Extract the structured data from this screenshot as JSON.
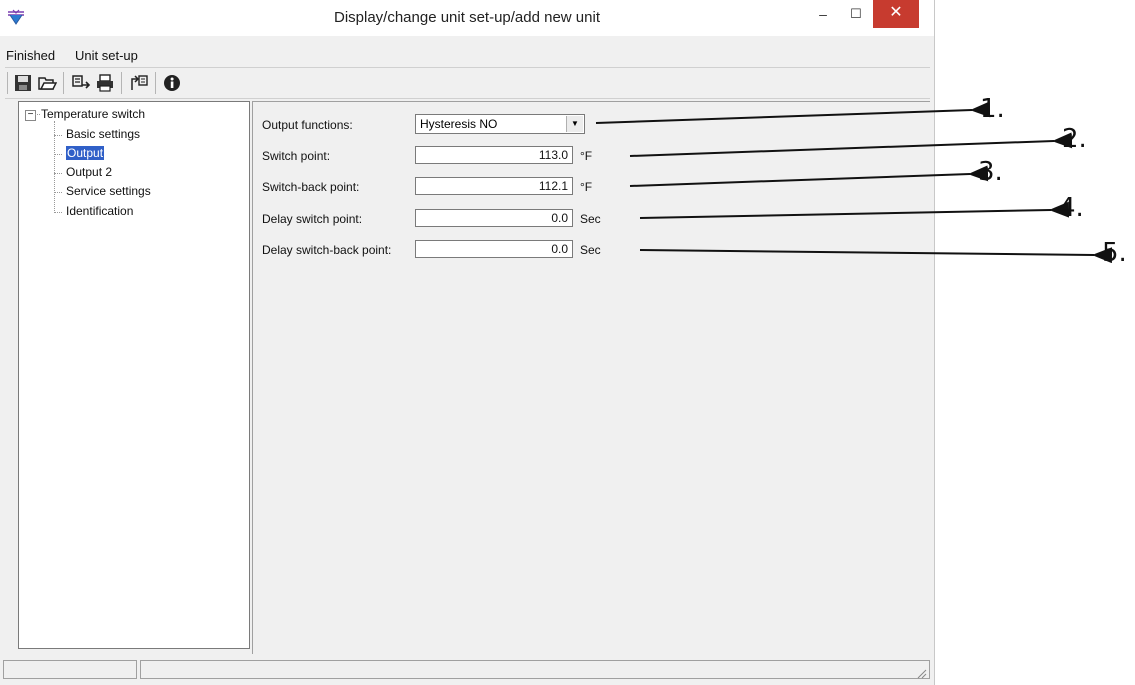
{
  "window": {
    "title": "Display/change unit set-up/add new unit",
    "close_glyph": "✕",
    "min_glyph": "–",
    "max_glyph": "☐"
  },
  "menu": {
    "items": [
      "Finished",
      "Unit set-up"
    ]
  },
  "toolbar": {
    "icons": [
      "save-icon",
      "open-icon",
      "read-unit-icon",
      "print-icon",
      "transfer-unit-icon",
      "info-icon"
    ]
  },
  "tree": {
    "root": "Temperature switch",
    "expander": "−",
    "items": [
      "Basic settings",
      "Output",
      "Output 2",
      "Service settings",
      "Identification"
    ],
    "selected": "Output"
  },
  "form": {
    "output_functions": {
      "label": "Output functions:",
      "value": "Hysteresis NO",
      "arrow": "▼"
    },
    "switch_point": {
      "label": "Switch point:",
      "value": "113.0",
      "unit": "°F"
    },
    "switch_back_point": {
      "label": "Switch-back point:",
      "value": "112.1",
      "unit": "°F"
    },
    "delay_switch_point": {
      "label": "Delay switch point:",
      "value": "0.0",
      "unit": "Sec"
    },
    "delay_switch_back_point": {
      "label": "Delay switch-back point:",
      "value": "0.0",
      "unit": "Sec"
    }
  },
  "callouts": [
    "1.",
    "2.",
    "3.",
    "4.",
    "5."
  ],
  "colors": {
    "close_button": "#c73b2f",
    "selection": "#3060c8"
  }
}
